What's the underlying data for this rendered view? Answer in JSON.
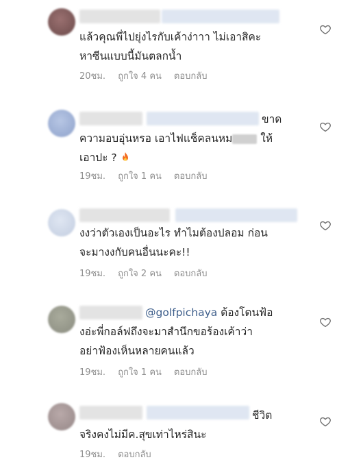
{
  "comments": [
    {
      "text_lines": [
        "แล้วคุณพี่ไปยุ่งไรกับเค้าง่าาา ไม่เอาสิคะ",
        "หาซีนแบบนี้มันตลกน้ำ"
      ],
      "time": "20ชม.",
      "likes": "ถูกใจ 4 คน",
      "reply": "ตอบกลับ"
    },
    {
      "text_lines": [
        "ขาด",
        "ความอบอุ่นหรอ เอาไฟแช็คลนหม",
        "ให้",
        "เอาปะ ?"
      ],
      "emoji": "fire-icon",
      "time": "19ชม.",
      "likes": "ถูกใจ 1 คน",
      "reply": "ตอบกลับ"
    },
    {
      "text_lines": [
        "งงว่าตัวเองเป็นอะไร ทำไมต้องปลอม ก่อน",
        "จะมางงกับคนอื่นนะคะ!!"
      ],
      "time": "19ชม.",
      "likes": "ถูกใจ 2 คน",
      "reply": "ตอบกลับ"
    },
    {
      "mention": "@golfpichaya",
      "text_lines": [
        " ต้องโดนฟ้อ",
        "งอ่ะพี่กอล์ฟถึงจะมาสำนึกขอร้องเค้าว่า",
        "อย่าฟ้องเห็นหลายคนแล้ว"
      ],
      "time": "19ชม.",
      "likes": "ถูกใจ 1 คน",
      "reply": "ตอบกลับ"
    },
    {
      "text_lines": [
        "ชีวิต",
        "จริงคงไม่มีค.สุขเท่าไหร่สินะ"
      ],
      "time": "19ชม.",
      "reply": "ตอบกลับ"
    }
  ],
  "colors": {
    "meta": "#8e8e8e",
    "mention": "#3c5d8a",
    "text": "#262626"
  },
  "icons": {
    "like": "heart-outline-icon"
  }
}
